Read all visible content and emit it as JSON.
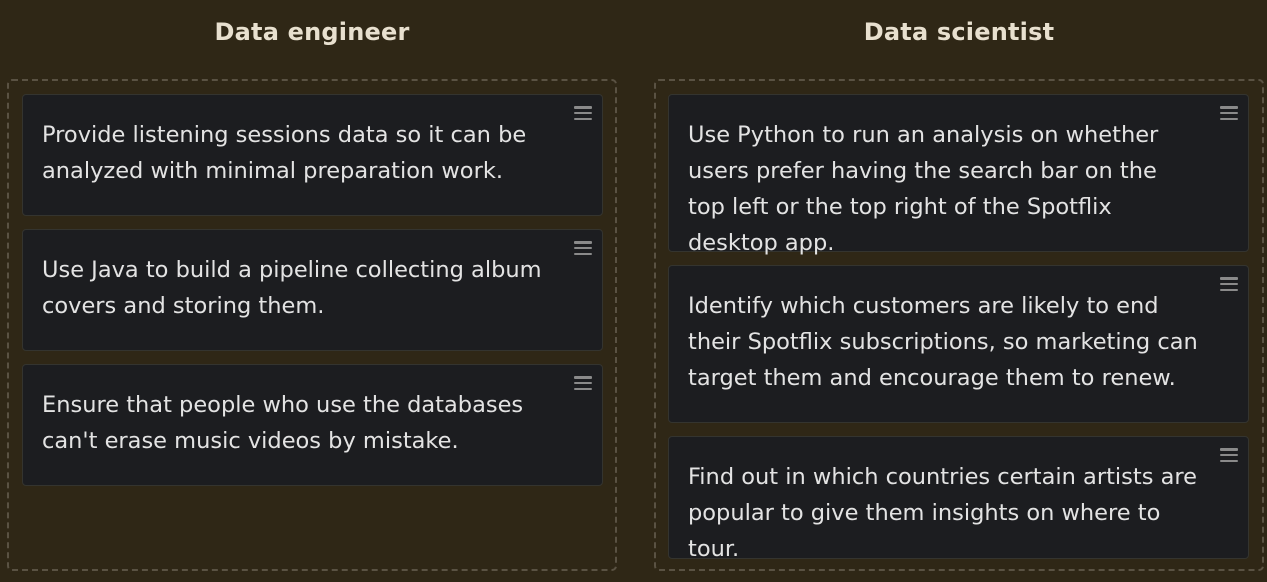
{
  "columns": [
    {
      "title": "Data engineer",
      "cards": [
        "Provide listening sessions data so it can be analyzed with minimal preparation work.",
        "Use Java to build a pipeline collecting album covers and storing them.",
        "Ensure that people who use the databases can't erase music videos by mistake."
      ]
    },
    {
      "title": "Data scientist",
      "cards": [
        "Use Python to run an analysis on whether users prefer having the search bar on the top left or the top right of the Spotflix desktop app.",
        "Identify which customers are likely to end their Spotflix subscriptions, so marketing can target them and encourage them to renew.",
        "Find out in which countries certain artists are popular to give them insights on where to tour."
      ]
    }
  ],
  "icons": {
    "drag_handle": "hamburger-drag-icon"
  },
  "colors": {
    "background": "#2f2716",
    "card": "#1c1d20",
    "text": "#e3e3e3",
    "dashed_border": "#5a5243"
  }
}
